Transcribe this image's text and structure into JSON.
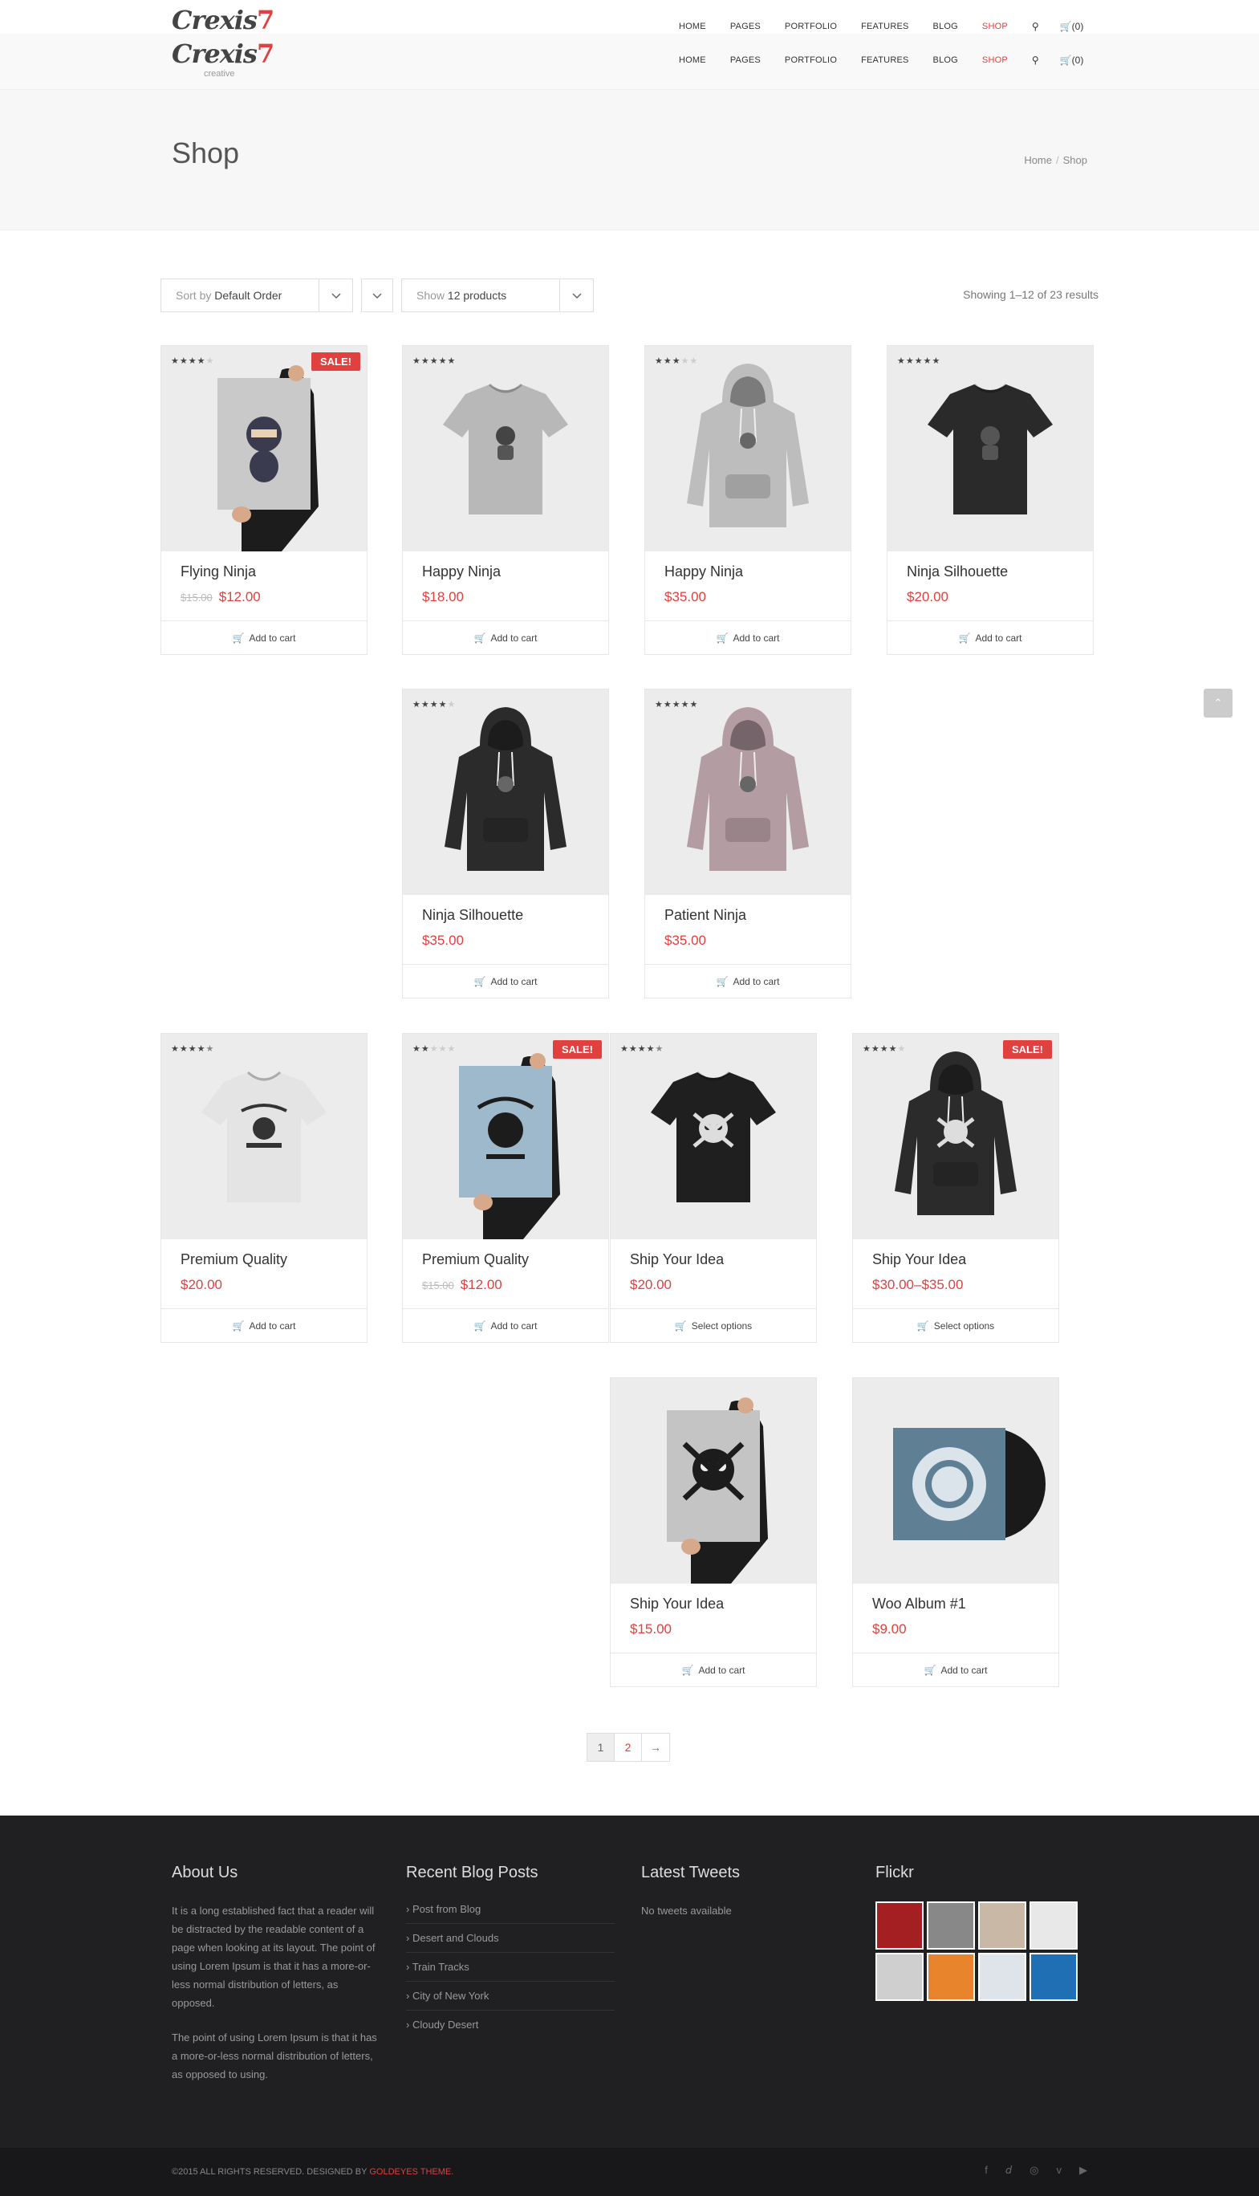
{
  "brand": {
    "name": "Crexis",
    "number": "7",
    "tagline": "creative"
  },
  "nav": {
    "items": [
      "HOME",
      "PAGES",
      "PORTFOLIO",
      "FEATURES",
      "BLOG",
      "SHOP"
    ],
    "active": "SHOP",
    "cart_count": "(0)"
  },
  "page": {
    "title": "Shop"
  },
  "breadcrumb": {
    "home": "Home",
    "sep": "/",
    "current": "Shop"
  },
  "toolbar": {
    "sort_prefix": "Sort by",
    "sort_value": "Default Order",
    "show_prefix": "Show",
    "show_value": "12 products",
    "results": "Showing 1–12 of 23 results"
  },
  "products": [
    {
      "name": "Flying Ninja",
      "old_price": "$15.00",
      "price": "$12.00",
      "rating": 4,
      "sale": true,
      "button": "Add to cart",
      "kind": "poster-ninja"
    },
    {
      "name": "Happy Ninja",
      "old_price": "",
      "price": "$18.00",
      "rating": 5,
      "sale": false,
      "button": "Add to cart",
      "kind": "tee-grey"
    },
    {
      "name": "Happy Ninja",
      "old_price": "",
      "price": "$35.00",
      "rating": 3,
      "sale": false,
      "button": "Add to cart",
      "kind": "hoodie-grey"
    },
    {
      "name": "Ninja Silhouette",
      "old_price": "",
      "price": "$20.00",
      "rating": 5,
      "sale": false,
      "button": "Add to cart",
      "kind": "tee-black"
    },
    {
      "name": "Ninja Silhouette",
      "old_price": "",
      "price": "$35.00",
      "rating": 4,
      "sale": false,
      "button": "Add to cart",
      "kind": "hoodie-black"
    },
    {
      "name": "Patient Ninja",
      "old_price": "",
      "price": "$35.00",
      "rating": 5,
      "sale": false,
      "button": "Add to cart",
      "kind": "hoodie-pink"
    },
    {
      "name": "Premium Quality",
      "old_price": "",
      "price": "$20.00",
      "rating": 4.5,
      "sale": false,
      "button": "Add to cart",
      "kind": "tee-white"
    },
    {
      "name": "Premium Quality",
      "old_price": "$15.00",
      "price": "$12.00",
      "rating": 2,
      "sale": true,
      "button": "Add to cart",
      "kind": "poster-blue"
    },
    {
      "name": "Ship Your Idea",
      "old_price": "",
      "price": "$20.00",
      "rating": 4.5,
      "sale": false,
      "button": "Select options",
      "kind": "tee-skull"
    },
    {
      "name": "Ship Your Idea",
      "old_price": "",
      "price": "$30.00–$35.00",
      "rating": 4,
      "sale": true,
      "button": "Select options",
      "kind": "hoodie-skull"
    },
    {
      "name": "Ship Your Idea",
      "old_price": "",
      "price": "$15.00",
      "rating": 0,
      "sale": false,
      "button": "Add to cart",
      "kind": "poster-skull"
    },
    {
      "name": "Woo Album #1",
      "old_price": "",
      "price": "$9.00",
      "rating": 0,
      "sale": false,
      "button": "Add to cart",
      "kind": "album"
    }
  ],
  "sale_label": "SALE!",
  "pagination": {
    "current": "1",
    "next_page": "2",
    "next_arrow": "→"
  },
  "footer": {
    "about_title": "About Us",
    "about_p1": "It is a long established fact that a reader will be distracted by the readable content of a page when looking at its layout. The point of using Lorem Ipsum is that it has a more-or-less normal distribution of letters, as opposed.",
    "about_p2": "The point of using Lorem Ipsum is that it has a more-or-less normal distribution of letters, as opposed to using.",
    "blog_title": "Recent Blog Posts",
    "blog_posts": [
      "Post from Blog",
      "Desert and Clouds",
      "Train Tracks",
      "City of New York",
      "Cloudy Desert"
    ],
    "tweets_title": "Latest Tweets",
    "tweets_empty": "No tweets available",
    "flickr_title": "Flickr",
    "flickr_colors": [
      "#a31f22",
      "#888888",
      "#c9b8a5",
      "#e8e8e8",
      "#cfcfcf",
      "#e8842c",
      "#dfe4ea",
      "#1f6fb5"
    ],
    "copyright": "©2015 ALL RIGHTS RESERVED. DESIGNED BY ",
    "designer": "GOLDEYES THEME.",
    "social": [
      "facebook-icon",
      "twitter-icon",
      "dribbble-icon",
      "vimeo-icon",
      "youtube-icon"
    ]
  },
  "colors": {
    "accent": "#e0403e",
    "footer_bg": "#202022"
  }
}
